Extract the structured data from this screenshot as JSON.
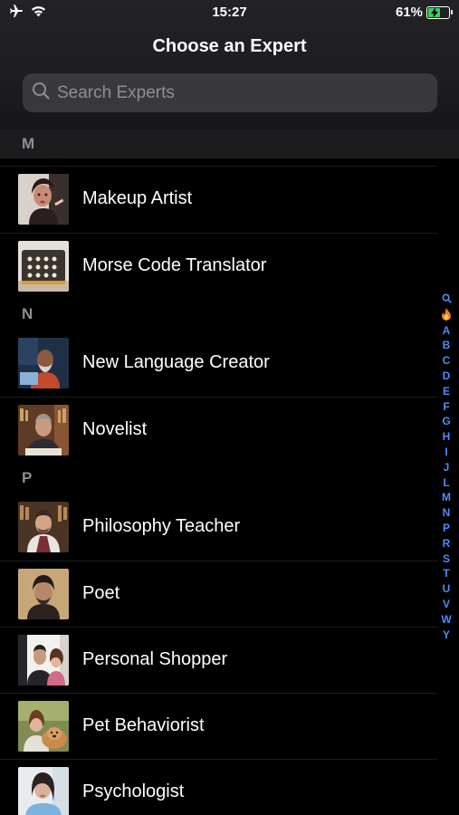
{
  "status_bar": {
    "time": "15:27",
    "battery_percent": "61%",
    "battery_level": 0.61
  },
  "header": {
    "title": "Choose an Expert"
  },
  "search": {
    "placeholder": "Search Experts"
  },
  "sections": [
    {
      "letter": "M",
      "items": [
        "Makeup Artist",
        "Morse Code Translator"
      ]
    },
    {
      "letter": "N",
      "items": [
        "New Language Creator",
        "Novelist"
      ]
    },
    {
      "letter": "P",
      "items": [
        "Philosophy Teacher",
        "Poet",
        "Personal Shopper",
        "Pet Behaviorist",
        "Psychologist"
      ]
    }
  ],
  "index": [
    "A",
    "B",
    "C",
    "D",
    "E",
    "F",
    "G",
    "H",
    "I",
    "J",
    "L",
    "M",
    "N",
    "P",
    "R",
    "S",
    "T",
    "U",
    "V",
    "W",
    "Y"
  ],
  "colors": {
    "accent": "#4a8df8",
    "background": "#000000",
    "search_bg": "#39393d",
    "section_text": "#8e8e93"
  }
}
